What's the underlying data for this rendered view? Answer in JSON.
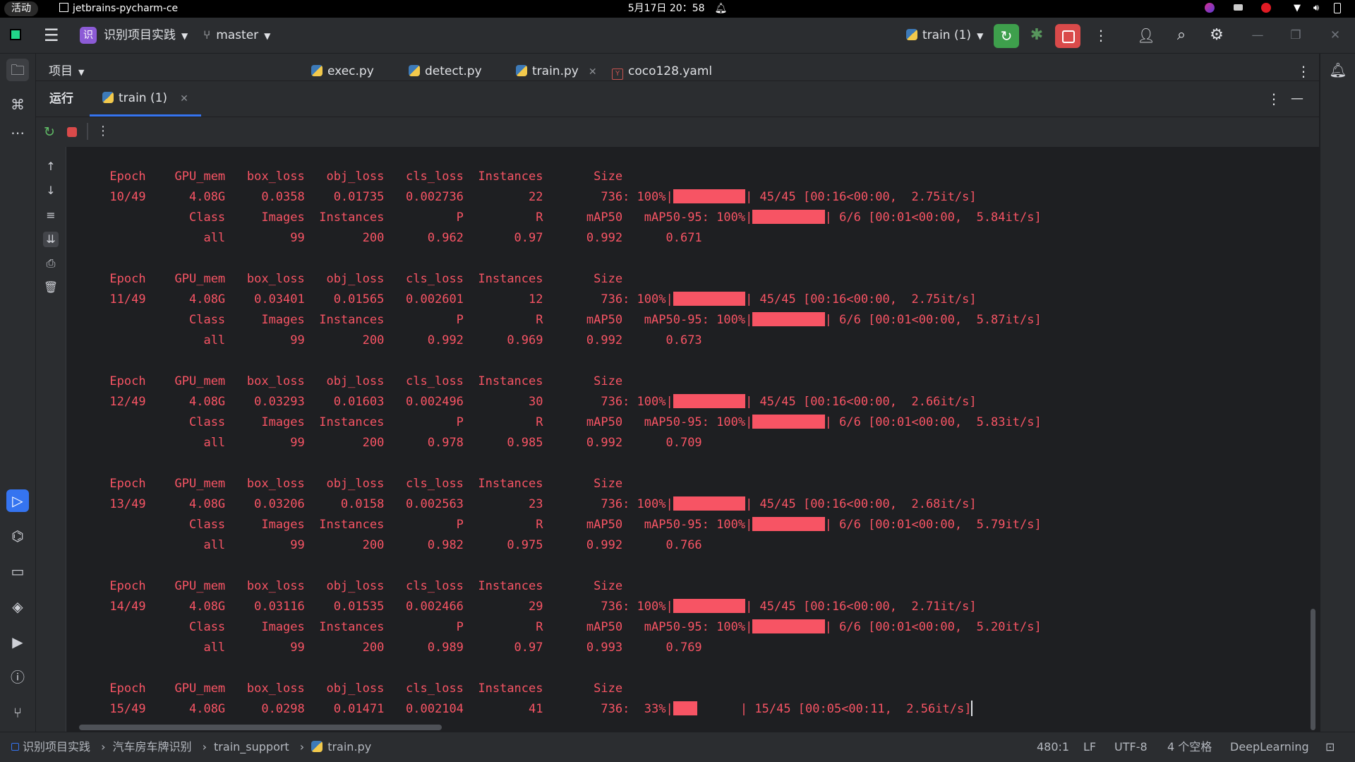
{
  "system_bar": {
    "activities": "活动",
    "app_name": "jetbrains-pycharm-ce",
    "clock": "5月17日 20：58"
  },
  "header": {
    "project_badge": "识",
    "project_name": "识别项目实践",
    "branch": "master",
    "run_config": "train (1)"
  },
  "tool_window": {
    "project_label": "项目"
  },
  "editor_tabs": [
    {
      "label": "exec.py",
      "icon": "python-file-icon"
    },
    {
      "label": "detect.py",
      "icon": "python-file-icon"
    },
    {
      "label": "train.py",
      "icon": "python-file-icon",
      "active": true
    },
    {
      "label": "coco128.yaml",
      "icon": "yaml-file-icon"
    }
  ],
  "run_panel": {
    "title": "运行",
    "tab_label": "train (1)"
  },
  "console": {
    "text_color": "#f75464",
    "epochs": [
      {
        "header": "      Epoch    GPU_mem   box_loss   obj_loss   cls_loss  Instances       Size",
        "train_pre": "      10/49      4.08G     0.0358    0.01735   0.002736         22        736: 100%|",
        "train_bar": 1.0,
        "train_post": "| 45/45 [00:16<00:00,  2.75it/s]",
        "val_pre": "                 Class     Images  Instances          P          R      mAP50   mAP50-95: 100%|",
        "val_post": "| 6/6 [00:01<00:00,  5.84it/s]",
        "result": "                   all         99        200      0.962       0.97      0.992      0.671"
      },
      {
        "header": "      Epoch    GPU_mem   box_loss   obj_loss   cls_loss  Instances       Size",
        "train_pre": "      11/49      4.08G    0.03401    0.01565   0.002601         12        736: 100%|",
        "train_bar": 1.0,
        "train_post": "| 45/45 [00:16<00:00,  2.75it/s]",
        "val_pre": "                 Class     Images  Instances          P          R      mAP50   mAP50-95: 100%|",
        "val_post": "| 6/6 [00:01<00:00,  5.87it/s]",
        "result": "                   all         99        200      0.992      0.969      0.992      0.673"
      },
      {
        "header": "      Epoch    GPU_mem   box_loss   obj_loss   cls_loss  Instances       Size",
        "train_pre": "      12/49      4.08G    0.03293    0.01603   0.002496         30        736: 100%|",
        "train_bar": 1.0,
        "train_post": "| 45/45 [00:16<00:00,  2.66it/s]",
        "val_pre": "                 Class     Images  Instances          P          R      mAP50   mAP50-95: 100%|",
        "val_post": "| 6/6 [00:01<00:00,  5.83it/s]",
        "result": "                   all         99        200      0.978      0.985      0.992      0.709"
      },
      {
        "header": "      Epoch    GPU_mem   box_loss   obj_loss   cls_loss  Instances       Size",
        "train_pre": "      13/49      4.08G    0.03206     0.0158   0.002563         23        736: 100%|",
        "train_bar": 1.0,
        "train_post": "| 45/45 [00:16<00:00,  2.68it/s]",
        "val_pre": "                 Class     Images  Instances          P          R      mAP50   mAP50-95: 100%|",
        "val_post": "| 6/6 [00:01<00:00,  5.79it/s]",
        "result": "                   all         99        200      0.982      0.975      0.992      0.766"
      },
      {
        "header": "      Epoch    GPU_mem   box_loss   obj_loss   cls_loss  Instances       Size",
        "train_pre": "      14/49      4.08G    0.03116    0.01535   0.002466         29        736: 100%|",
        "train_bar": 1.0,
        "train_post": "| 45/45 [00:16<00:00,  2.71it/s]",
        "val_pre": "                 Class     Images  Instances          P          R      mAP50   mAP50-95: 100%|",
        "val_post": "| 6/6 [00:01<00:00,  5.20it/s]",
        "result": "                   all         99        200      0.989       0.97      0.993      0.769"
      },
      {
        "header": "      Epoch    GPU_mem   box_loss   obj_loss   cls_loss  Instances       Size",
        "train_pre": "      15/49      4.08G     0.0298    0.01471   0.002104         41        736:  33%|",
        "train_bar": 0.33,
        "train_post": "      | 15/45 [00:05<00:11,  2.56it/s]"
      }
    ]
  },
  "breadcrumb": [
    "识别项目实践",
    "汽车房车牌识别",
    "train_support",
    "train.py"
  ],
  "status_bar": {
    "position": "480:1",
    "line_ending": "LF",
    "encoding": "UTF-8",
    "indent": "4 个空格",
    "interpreter": "DeepLearning"
  }
}
